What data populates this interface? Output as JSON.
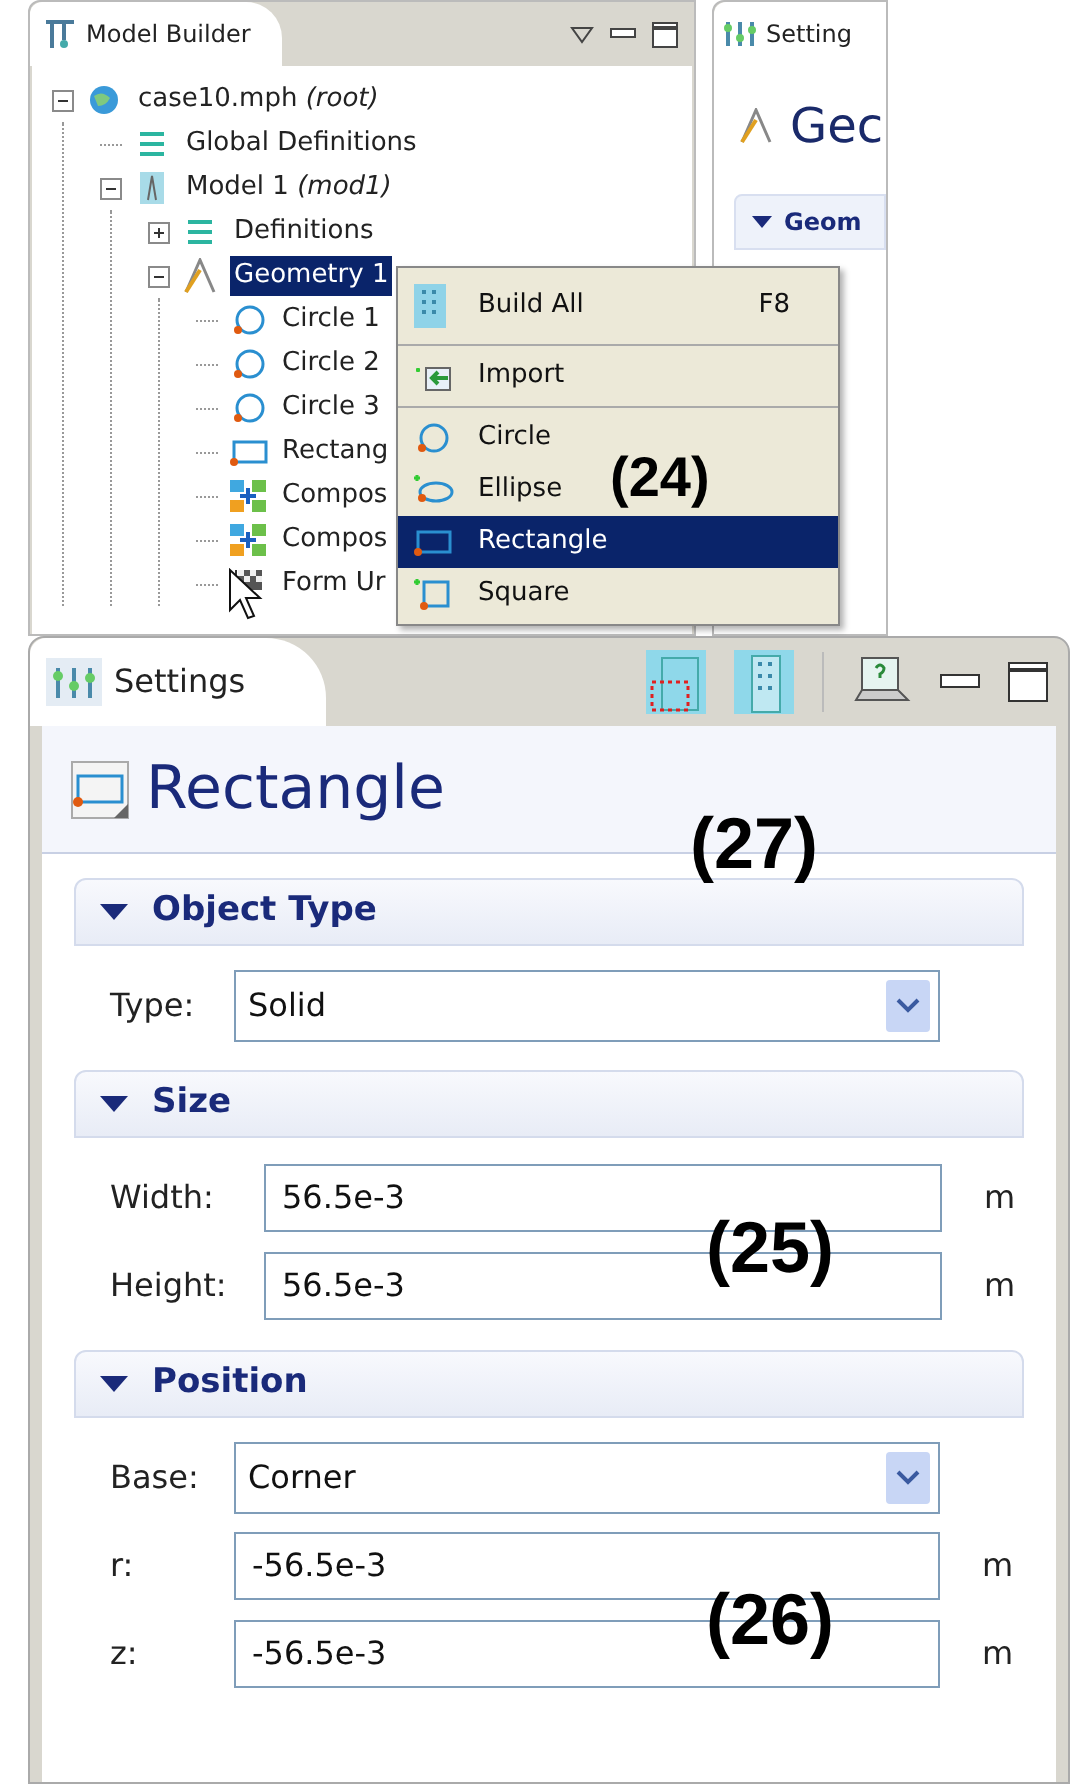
{
  "model_builder": {
    "title": "Model Builder",
    "tree": [
      {
        "label": "case10.mph *(root)*",
        "kind": "root",
        "expanded": true,
        "selected": false,
        "children": [
          {
            "label": "Global Definitions",
            "kind": "definitions",
            "selected": false
          },
          {
            "label": "Model 1 *(mod1)*",
            "kind": "model",
            "expanded": true,
            "selected": false,
            "children": [
              {
                "label": "Definitions",
                "kind": "definitions",
                "expanded": false,
                "selected": false
              },
              {
                "label": "Geometry 1",
                "kind": "geometry",
                "expanded": true,
                "selected": true,
                "children": [
                  {
                    "label": "Circle 1",
                    "kind": "circle",
                    "selected": false
                  },
                  {
                    "label": "Circle 2",
                    "kind": "circle",
                    "selected": false
                  },
                  {
                    "label": "Circle 3",
                    "kind": "circle",
                    "selected": false
                  },
                  {
                    "label": "Rectang",
                    "kind": "rectangle",
                    "selected": false
                  },
                  {
                    "label": "Compos",
                    "kind": "composite",
                    "selected": false
                  },
                  {
                    "label": "Compos",
                    "kind": "composite",
                    "selected": false
                  },
                  {
                    "label": "Form Ur",
                    "kind": "form",
                    "selected": false
                  }
                ]
              }
            ]
          }
        ]
      }
    ]
  },
  "settings_behind": {
    "title": "Setting",
    "heading": "Gec",
    "section": "Geom"
  },
  "context_menu": {
    "callout": "(24)",
    "groups": [
      [
        {
          "label": "Build All",
          "shortcut": "F8",
          "kind": "build",
          "selected": false
        }
      ],
      [
        {
          "label": "Import",
          "kind": "import",
          "selected": false
        }
      ],
      [
        {
          "label": "Circle",
          "kind": "circle",
          "selected": false
        },
        {
          "label": "Ellipse",
          "kind": "ellipse",
          "selected": false
        },
        {
          "label": "Rectangle",
          "kind": "rectangle",
          "selected": true
        },
        {
          "label": "Square",
          "kind": "square",
          "selected": false
        }
      ]
    ]
  },
  "settings": {
    "title": "Settings",
    "heading": "Rectangle",
    "callout": "(27)",
    "sections": [
      {
        "title": "Object Type",
        "expanded": true,
        "fields": [
          {
            "kind": "select",
            "label": "Type:",
            "value": "Solid"
          }
        ]
      },
      {
        "title": "Size",
        "expanded": true,
        "callout": "(25)",
        "fields": [
          {
            "kind": "text",
            "label": "Width:",
            "value": "56.5e-3",
            "unit": "m"
          },
          {
            "kind": "text",
            "label": "Height:",
            "value": "56.5e-3",
            "unit": "m"
          }
        ]
      },
      {
        "title": "Position",
        "expanded": true,
        "callout": "(26)",
        "fields": [
          {
            "kind": "select",
            "label": "Base:",
            "value": "Corner"
          },
          {
            "kind": "text",
            "label": "r:",
            "value": "-56.5e-3",
            "unit": "m"
          },
          {
            "kind": "text",
            "label": "z:",
            "value": "-56.5e-3",
            "unit": "m"
          }
        ]
      }
    ]
  }
}
